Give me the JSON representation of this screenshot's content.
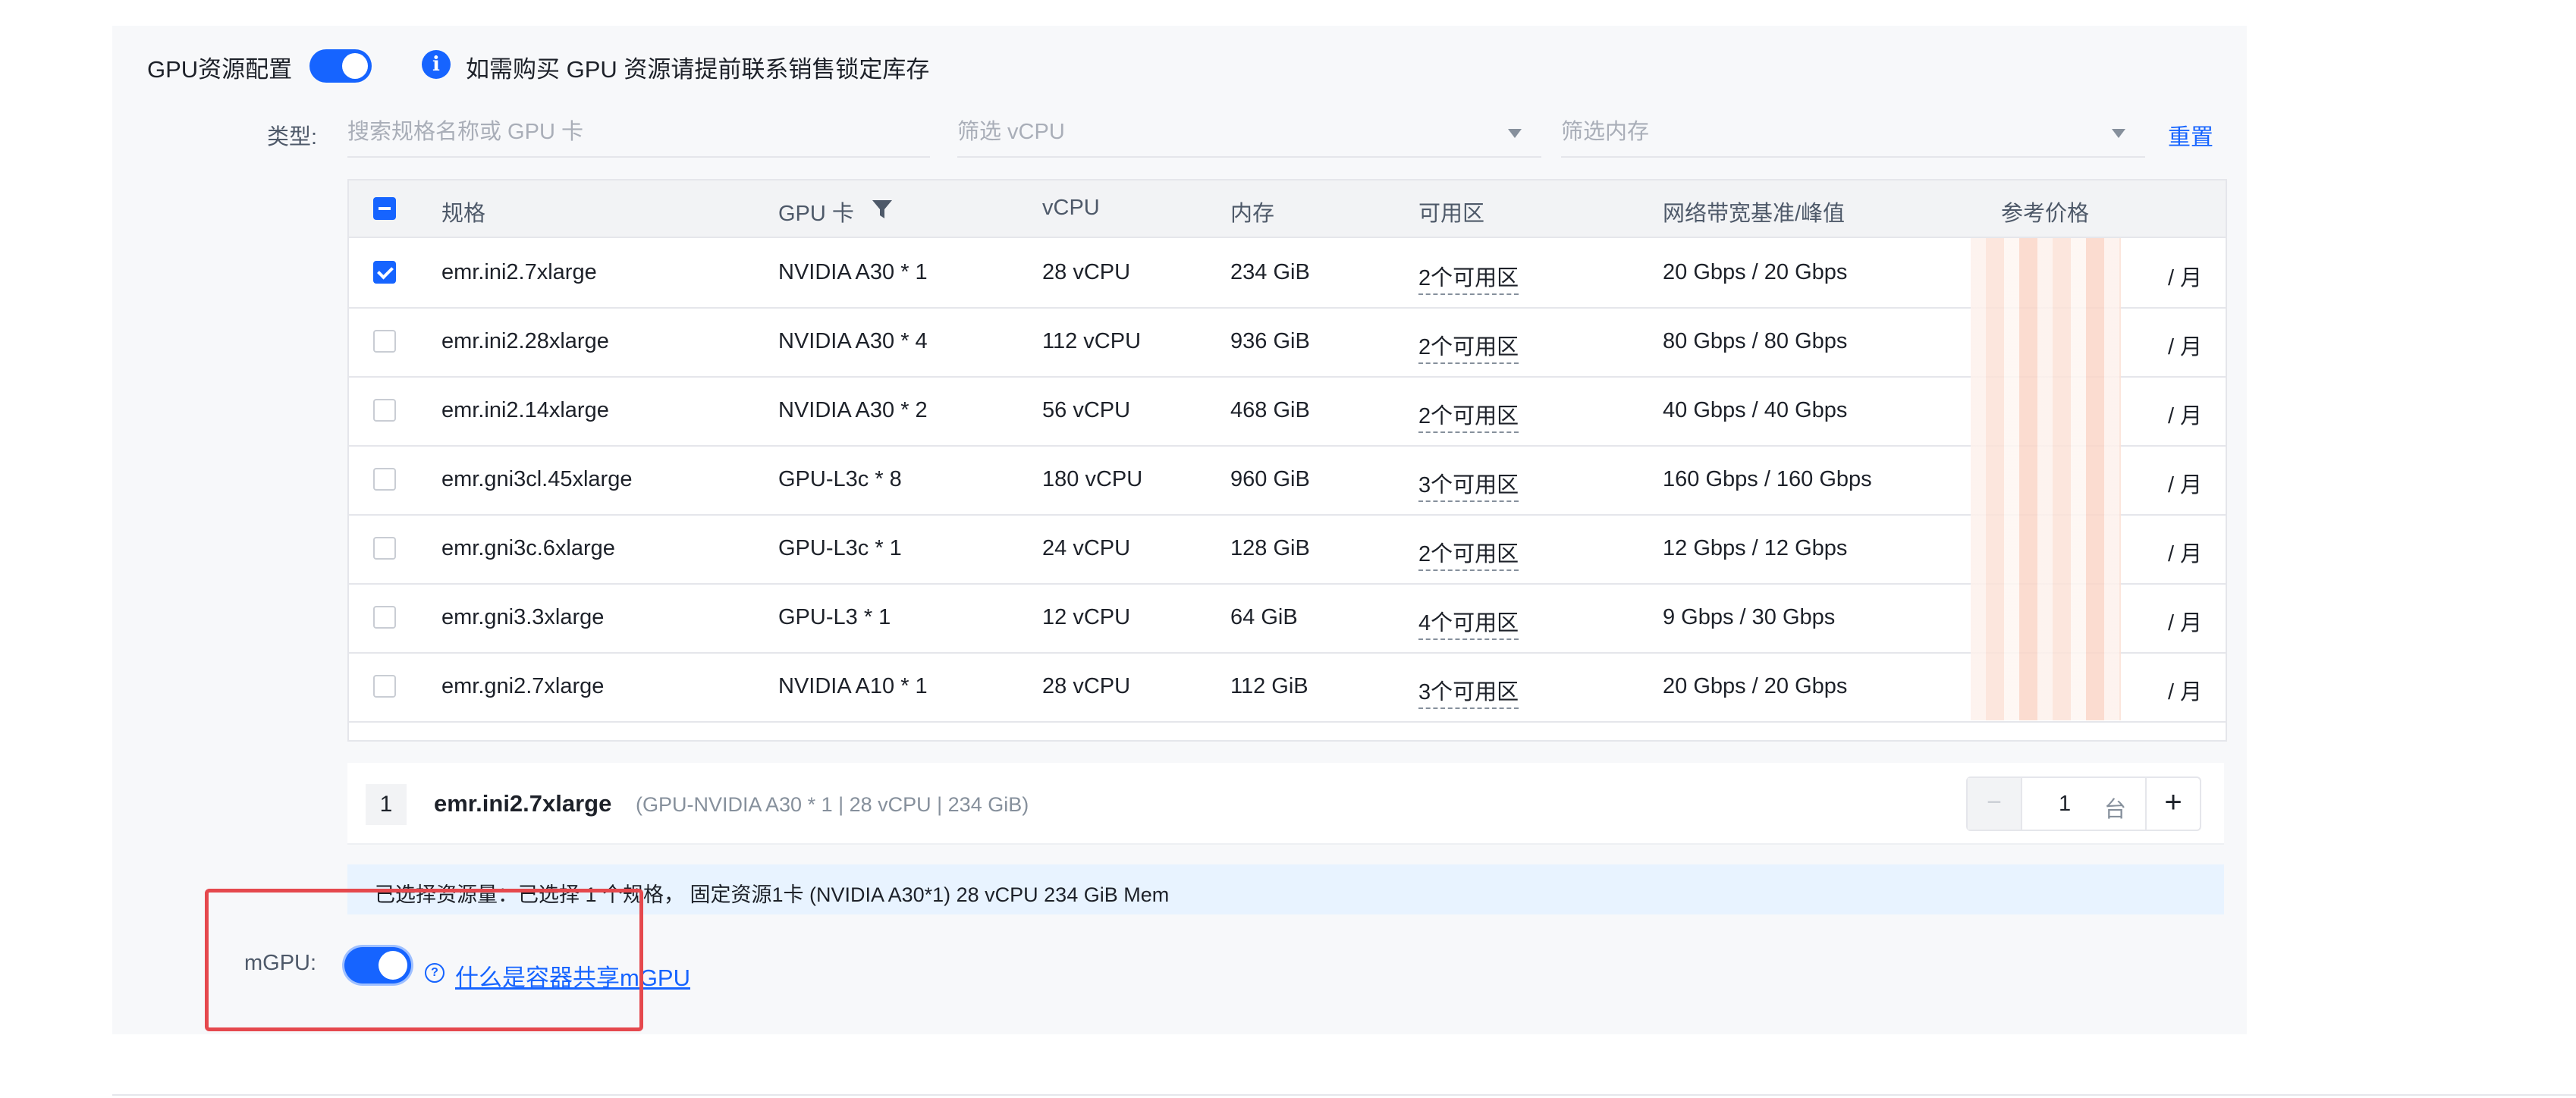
{
  "gpu": {
    "label": "GPU资源配置",
    "enabled": true,
    "info_text": "如需购买 GPU 资源请提前联系销售锁定库存",
    "info_icon": "info-icon"
  },
  "filters": {
    "type_label": "类型:",
    "search_placeholder": "搜索规格名称或 GPU 卡",
    "vcpu_placeholder": "筛选 vCPU",
    "memory_placeholder": "筛选内存",
    "reset_label": "重置"
  },
  "table": {
    "headers": {
      "spec": "规格",
      "gpu": "GPU 卡",
      "vcpu": "vCPU",
      "memory": "内存",
      "zones": "可用区",
      "bandwidth": "网络带宽基准/峰值",
      "price": "参考价格"
    },
    "rows": [
      {
        "checked": true,
        "spec": "emr.ini2.7xlarge",
        "gpu": "NVIDIA A30 * 1",
        "vcpu": "28 vCPU",
        "memory": "234 GiB",
        "zones": "2个可用区",
        "bandwidth": "20 Gbps / 20 Gbps",
        "price_unit": "/ 月"
      },
      {
        "checked": false,
        "spec": "emr.ini2.28xlarge",
        "gpu": "NVIDIA A30 * 4",
        "vcpu": "112 vCPU",
        "memory": "936 GiB",
        "zones": "2个可用区",
        "bandwidth": "80 Gbps / 80 Gbps",
        "price_unit": "/ 月"
      },
      {
        "checked": false,
        "spec": "emr.ini2.14xlarge",
        "gpu": "NVIDIA A30 * 2",
        "vcpu": "56 vCPU",
        "memory": "468 GiB",
        "zones": "2个可用区",
        "bandwidth": "40 Gbps / 40 Gbps",
        "price_unit": "/ 月"
      },
      {
        "checked": false,
        "spec": "emr.gni3cl.45xlarge",
        "gpu": "GPU-L3c * 8",
        "vcpu": "180 vCPU",
        "memory": "960 GiB",
        "zones": "3个可用区",
        "bandwidth": "160 Gbps / 160 Gbps",
        "price_unit": "/ 月"
      },
      {
        "checked": false,
        "spec": "emr.gni3c.6xlarge",
        "gpu": "GPU-L3c * 1",
        "vcpu": "24 vCPU",
        "memory": "128 GiB",
        "zones": "2个可用区",
        "bandwidth": "12 Gbps / 12 Gbps",
        "price_unit": "/ 月"
      },
      {
        "checked": false,
        "spec": "emr.gni3.3xlarge",
        "gpu": "GPU-L3 * 1",
        "vcpu": "12 vCPU",
        "memory": "64 GiB",
        "zones": "4个可用区",
        "bandwidth": "9 Gbps / 30 Gbps",
        "price_unit": "/ 月"
      },
      {
        "checked": false,
        "spec": "emr.gni2.7xlarge",
        "gpu": "NVIDIA A10 * 1",
        "vcpu": "28 vCPU",
        "memory": "112 GiB",
        "zones": "3个可用区",
        "bandwidth": "20 Gbps / 20 Gbps",
        "price_unit": "/ 月"
      }
    ]
  },
  "selected": {
    "index": "1",
    "name": "emr.ini2.7xlarge",
    "spec": "(GPU-NVIDIA A30 * 1 | 28 vCPU | 234 GiB)",
    "quantity": "1",
    "unit": "台",
    "minus": "−",
    "plus": "+"
  },
  "summary": {
    "text": "已选择资源量：已选择 1 个规格， 固定资源1卡 (NVIDIA A30*1) 28 vCPU 234 GiB Mem"
  },
  "mgpu": {
    "label": "mGPU:",
    "enabled": true,
    "help_icon": "help-circle-icon",
    "link": "什么是容器共享mGPU"
  },
  "colors": {
    "accent": "#1664ff",
    "highlight": "#e5484d",
    "summary_bg": "#e8f3ff"
  }
}
